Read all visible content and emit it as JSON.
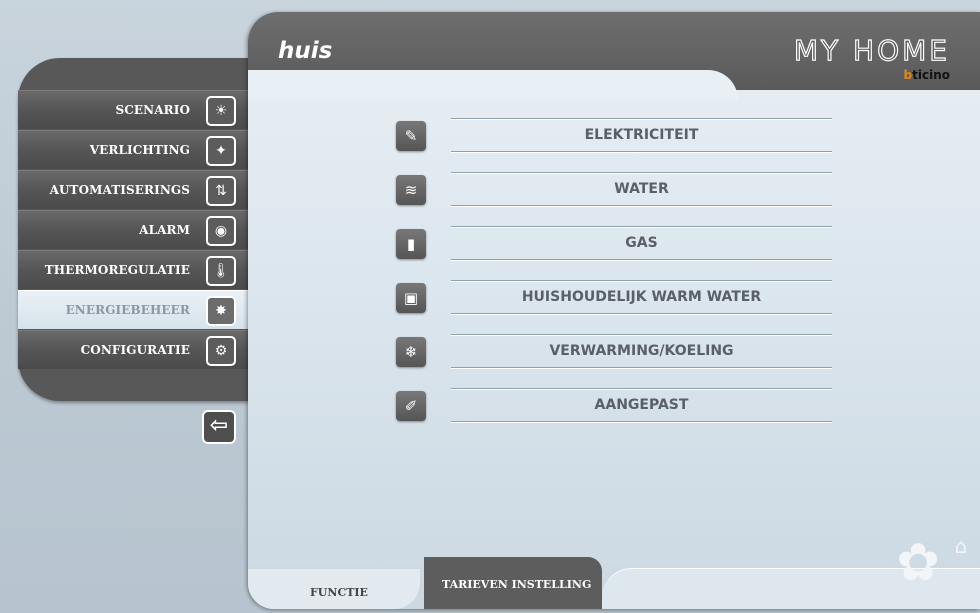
{
  "header": {
    "title": "huis",
    "brand_name": "MY HOME",
    "brand_sub_b": "b",
    "brand_sub_rest": "ticino"
  },
  "sidebar": {
    "items": [
      {
        "label": "SCENARIO",
        "icon": "sun-icon",
        "glyph": "☀"
      },
      {
        "label": "VERLICHTING",
        "icon": "lightbulb-icon",
        "glyph": "✦"
      },
      {
        "label": "AUTOMATISERINGS",
        "icon": "shutter-icon",
        "glyph": "⇅"
      },
      {
        "label": "ALARM",
        "icon": "alarm-icon",
        "glyph": "◉"
      },
      {
        "label": "THERMOREGULATIE",
        "icon": "thermometer-icon",
        "glyph": "🌡"
      },
      {
        "label": "ENERGIEBEHEER",
        "icon": "energy-icon",
        "glyph": "✸",
        "active": true
      },
      {
        "label": "CONFIGURATIE",
        "icon": "gears-icon",
        "glyph": "⚙"
      }
    ],
    "back_glyph": "⇦"
  },
  "energy_items": [
    {
      "label": "ELEKTRICITEIT",
      "icon": "electricity-icon",
      "glyph": "✎"
    },
    {
      "label": "WATER",
      "icon": "water-icon",
      "glyph": "≋"
    },
    {
      "label": "GAS",
      "icon": "gas-icon",
      "glyph": "▮"
    },
    {
      "label": "HUISHOUDELIJK WARM WATER",
      "icon": "boiler-icon",
      "glyph": "▣"
    },
    {
      "label": "VERWARMING/KOELING",
      "icon": "heating-cooling-icon",
      "glyph": "❄"
    },
    {
      "label": "AANGEPAST",
      "icon": "custom-icon",
      "glyph": "✐"
    }
  ],
  "bottom_tabs": {
    "functie": "FUNCTIE",
    "tarieven": "TARIEVEN INSTELLING"
  },
  "colors": {
    "panel_dark": "#585858",
    "panel_light": "#e9f0f5",
    "accent_bticino": "#e8870e"
  }
}
